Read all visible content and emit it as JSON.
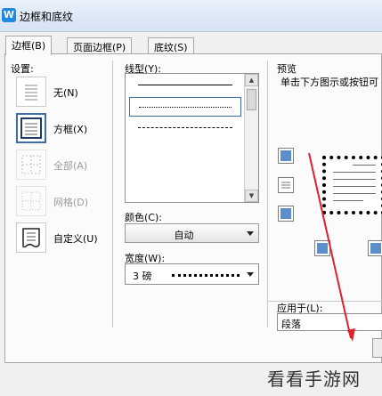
{
  "window": {
    "title": "边框和底纹",
    "app_icon_glyph": "W"
  },
  "tabs": [
    {
      "label": "边框(B)",
      "active": true
    },
    {
      "label": "页面边框(P)",
      "active": false
    },
    {
      "label": "底纹(S)",
      "active": false
    }
  ],
  "settings": {
    "label": "设置:",
    "items": [
      {
        "name": "无(N)",
        "icon": "none-border-icon",
        "selected": false,
        "disabled": false
      },
      {
        "name": "方框(X)",
        "icon": "box-border-icon",
        "selected": true,
        "disabled": false
      },
      {
        "name": "全部(A)",
        "icon": "all-border-icon",
        "selected": false,
        "disabled": true
      },
      {
        "name": "网格(D)",
        "icon": "grid-border-icon",
        "selected": false,
        "disabled": true
      },
      {
        "name": "自定义(U)",
        "icon": "custom-border-icon",
        "selected": false,
        "disabled": false
      }
    ]
  },
  "line_style": {
    "label": "线型(Y):",
    "styles": [
      "solid",
      "dotted-fine",
      "dashed-short",
      "dashed",
      "dash-dot",
      "dash-dot-dot"
    ],
    "selected": "dotted-fine"
  },
  "color": {
    "label": "颜色(C):",
    "value": "自动"
  },
  "width": {
    "label": "宽度(W):",
    "value": "3 磅"
  },
  "preview": {
    "label": "预览",
    "instruction": "单击下方图示或按钮可"
  },
  "apply_to": {
    "label": "应用于(L):",
    "value": "段落"
  },
  "watermark": "看看手游网",
  "colors": {
    "selected_blue": "#3a6ea5",
    "edge_button_fill": "#5c8fc9",
    "annotation_red": "#e0202a"
  }
}
